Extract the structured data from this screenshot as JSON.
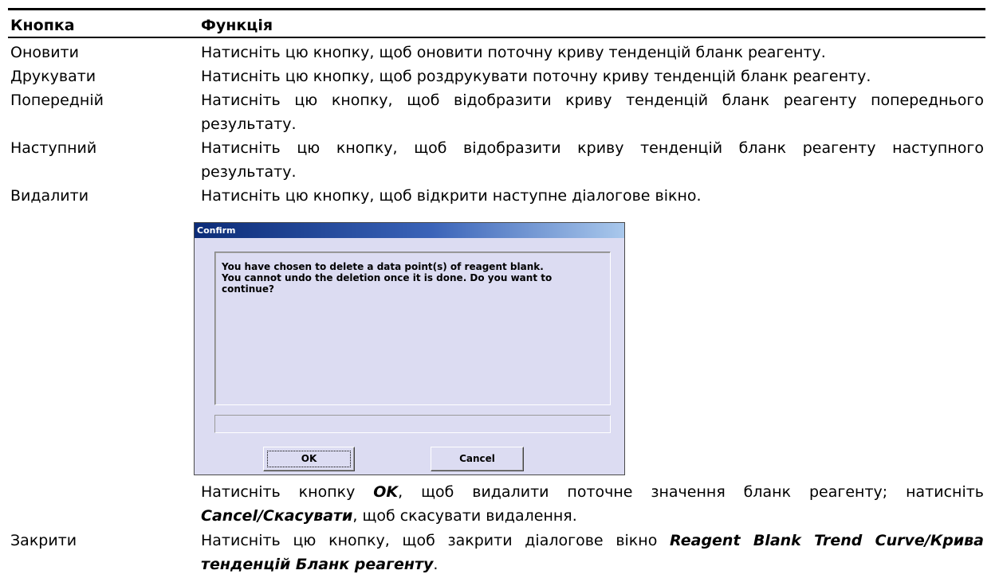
{
  "table": {
    "header": {
      "col_button": "Кнопка",
      "col_function": "Функція"
    },
    "rows": [
      {
        "button": "Оновити",
        "function": "Натисніть цю кнопку, щоб оновити поточну криву тенденцій бланк реагенту."
      },
      {
        "button": "Друкувати",
        "function": "Натисніть цю кнопку, щоб роздрукувати поточну криву тенденцій бланк реагенту."
      },
      {
        "button": "Попередній",
        "function_line1": "Натисніть цю кнопку, щоб відобразити криву тенденцій бланк реагенту попереднього",
        "function_line2": "результату."
      },
      {
        "button": "Наступний",
        "function_line1": "Натисніть цю кнопку, щоб відобразити криву тенденцій бланк реагенту наступного",
        "function_line2": "результату."
      },
      {
        "button": "Видалити",
        "function": "Натисніть цю кнопку, щоб відкрити наступне діалогове вікно.",
        "after_dialog": {
          "line1_pre": "Натисніть кнопку ",
          "line1_bold": "OK",
          "line1_post": ", щоб видалити поточне значення бланк реагенту; натисніть",
          "line2_bold": "Cancel/Скасувати",
          "line2_post": ", щоб скасувати видалення."
        }
      },
      {
        "button": "Закрити",
        "function_line1_pre": "Натисніть цю кнопку, щоб закрити діалогове вікно ",
        "function_line1_bold": "Reagent Blank Trend Curve/Крива",
        "function_line2_bold": "тенденцій Бланк реагенту",
        "function_line2_post": "."
      }
    ]
  },
  "dialog": {
    "title": "Confirm",
    "message": "You have chosen to  delete a data point(s) of reagent blank. You cannot undo the deletion once it is done. Do you want to continue?",
    "message_line1": "You have chosen to  delete a data point(s) of reagent blank.",
    "message_line2": "You cannot undo the deletion once it is done. Do you want to",
    "message_line3": "continue?",
    "ok_label": "OK",
    "cancel_label": "Cancel",
    "colors": {
      "title_start": "#0c2c78",
      "title_end": "#a9c8ec",
      "background": "#dcdcf2"
    }
  }
}
